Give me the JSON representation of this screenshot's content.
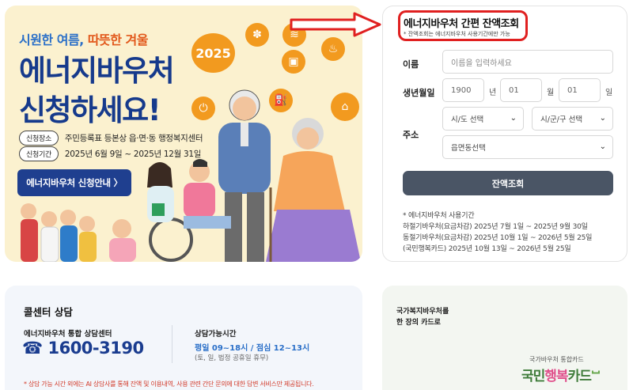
{
  "banner": {
    "slogan_cool": "시원한 여름,",
    "slogan_warm": "따뜻한 겨울",
    "year": "2025",
    "title_line1": "에너지바우처",
    "title_line2": "신청하세요!",
    "place_tag": "신청장소",
    "place_text": "주민등록표 등본상 읍·면·동 행정복지센터",
    "period_tag": "신청기간",
    "period_text": "2025년 6월 9일 ~ 2025년 12월 31일",
    "apply_label": "에너지바우처 신청안내 〉",
    "icons": [
      "fan-icon",
      "ac-icon",
      "gas-icon",
      "heater-icon",
      "plug-icon",
      "fuel-icon",
      "house-icon"
    ]
  },
  "panel": {
    "title": "에너지바우처 간편 잔액조회",
    "note": "* 잔액조회는 에너지바우처 사용기간에만 가능",
    "name_label": "이름",
    "name_placeholder": "이름을 입력하세요",
    "birth_label": "생년월일",
    "birth_year": "1900",
    "birth_year_unit": "년",
    "birth_month": "01",
    "birth_month_unit": "월",
    "birth_day": "01",
    "birth_day_unit": "일",
    "address_label": "주소",
    "sido": "시/도 선택",
    "sigungu": "시/군/구 선택",
    "eupmyeondong": "읍면동선택",
    "query_label": "잔액조회",
    "period_head": "* 에너지바우처 사용기간",
    "period_summer": "하절기바우처(요금차감) 2025년 7월 1일 ~ 2025년 9월 30일",
    "period_winter": "동절기바우처(요금차감) 2025년 10월 1일 ~ 2026년 5월 25일",
    "period_card": "(국민행복카드) 2025년 10월 13일 ~ 2026년 5월 25일"
  },
  "call": {
    "title": "콜센터 상담",
    "center": "에너지바우처 통합 상담센터",
    "phone": "☎ 1600-3190",
    "hours_title": "상담가능시간",
    "hours": "평일 09~18시 / 점심 12~13시",
    "hours_note": "(토, 일, 법정 공휴일 휴무)",
    "note": "* 상담 가능 시간 외에는 AI 상담사를 통해 잔액 및 이용내역, 사용 관련 간단 문의에 대한 답변 서비스만 제공됩니다."
  },
  "card": {
    "line1": "국가복지바우처를",
    "line2": "한 장의 카드로",
    "sub": "국가바우처 통합카드",
    "logo_a": "국민",
    "logo_b": "행복",
    "logo_c": "카드",
    "logo_mark": "ⵯ"
  },
  "colors": {
    "banner_bg": "#fbf1cf",
    "title_blue": "#163a8c",
    "accent_orange": "#f29a1f",
    "query_button": "#4a5565",
    "highlight_red": "#e02020"
  }
}
